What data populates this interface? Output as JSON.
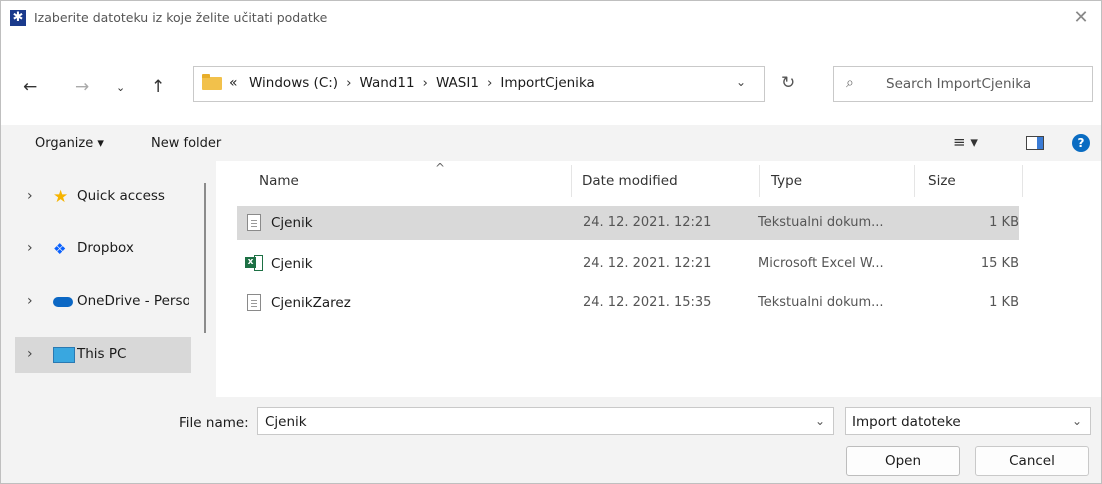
{
  "window": {
    "title": "Izaberite datoteku iz koje želite učitati podatke",
    "close_glyph": "✕"
  },
  "address": {
    "overflow": "«",
    "crumbs": [
      "Windows (C:)",
      "Wand11",
      "WASI1",
      "ImportCjenika"
    ],
    "separator": "›"
  },
  "search": {
    "placeholder": "Search ImportCjenika"
  },
  "toolbar": {
    "organize_label": "Organize ▾",
    "new_folder_label": "New folder",
    "help_label": "?"
  },
  "nav": {
    "items": [
      {
        "label": "Quick access",
        "icon": "star-icon"
      },
      {
        "label": "Dropbox",
        "icon": "dropbox-icon"
      },
      {
        "label": "OneDrive - Perso",
        "icon": "onedrive-icon"
      },
      {
        "label": "This PC",
        "icon": "this-pc-icon",
        "selected": true
      }
    ]
  },
  "columns": {
    "name": "Name",
    "date": "Date modified",
    "type": "Type",
    "size": "Size"
  },
  "files": [
    {
      "name": "Cjenik",
      "date": "24. 12. 2021. 12:21",
      "type": "Tekstualni dokum...",
      "size": "1 KB",
      "icon": "text-file-icon",
      "selected": true
    },
    {
      "name": "Cjenik",
      "date": "24. 12. 2021. 12:21",
      "type": "Microsoft Excel W...",
      "size": "15 KB",
      "icon": "excel-file-icon"
    },
    {
      "name": "CjenikZarez",
      "date": "24. 12. 2021. 15:35",
      "type": "Tekstualni dokum...",
      "size": "1 KB",
      "icon": "text-file-icon"
    }
  ],
  "bottom": {
    "file_name_label": "File name:",
    "file_name_value": "Cjenik",
    "filter_value": "Import datoteke",
    "open_label": "Open",
    "cancel_label": "Cancel"
  }
}
